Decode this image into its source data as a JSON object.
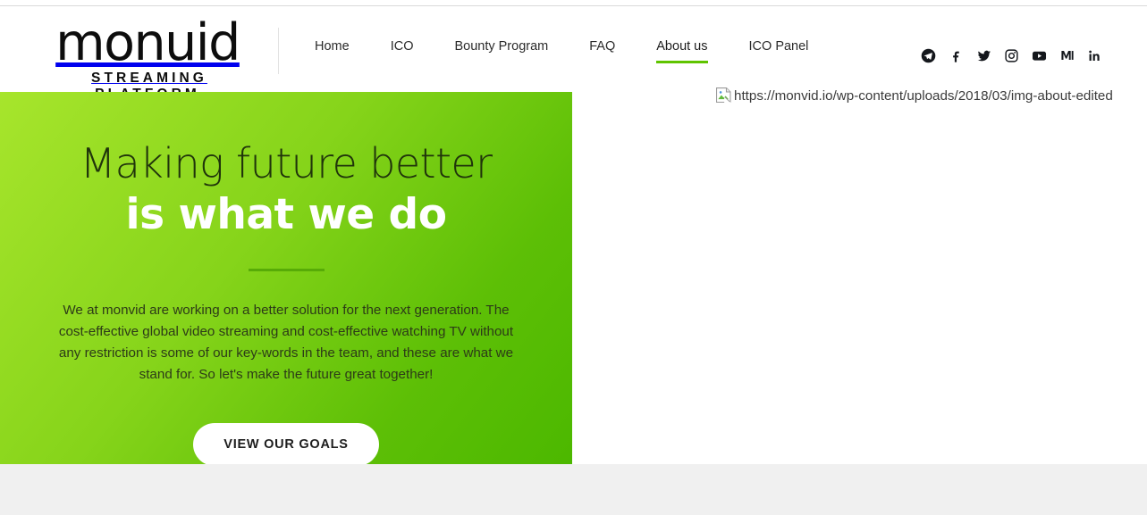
{
  "header": {
    "logo": {
      "word": "monuid",
      "tagline": "STREAMING PLATFORM"
    },
    "nav": [
      {
        "label": "Home",
        "active": false
      },
      {
        "label": "ICO",
        "active": false
      },
      {
        "label": "Bounty Program",
        "active": false
      },
      {
        "label": "FAQ",
        "active": false
      },
      {
        "label": "About us",
        "active": true
      },
      {
        "label": "ICO Panel",
        "active": false
      }
    ],
    "social": [
      {
        "name": "telegram-icon"
      },
      {
        "name": "facebook-icon"
      },
      {
        "name": "twitter-icon"
      },
      {
        "name": "instagram-icon"
      },
      {
        "name": "youtube-icon"
      },
      {
        "name": "medium-icon"
      },
      {
        "name": "linkedin-icon"
      }
    ]
  },
  "hero": {
    "title_line1": "Making future better",
    "title_line2": "is what we do",
    "paragraph": "We at monvid are working on a better solution for the next generation. The cost-effective global video streaming and cost-effective watching TV without any restriction is some of our key-words in the team, and these are what we stand for. So let's make the future great together!",
    "cta_label": "VIEW OUR GOALS",
    "gradient_from": "#a7e52c",
    "gradient_to": "#4cb800",
    "divider_color": "#57ab07"
  },
  "media": {
    "broken_image_alt": "https://monvid.io/wp-content/uploads/2018/03/img-about-edited",
    "icon_name": "broken-image-icon"
  },
  "colors": {
    "accent_green": "#5fc400",
    "text_dark": "#2b2b2b",
    "page_background": "#ffffff",
    "lower_strip": "#f0f0f0"
  }
}
